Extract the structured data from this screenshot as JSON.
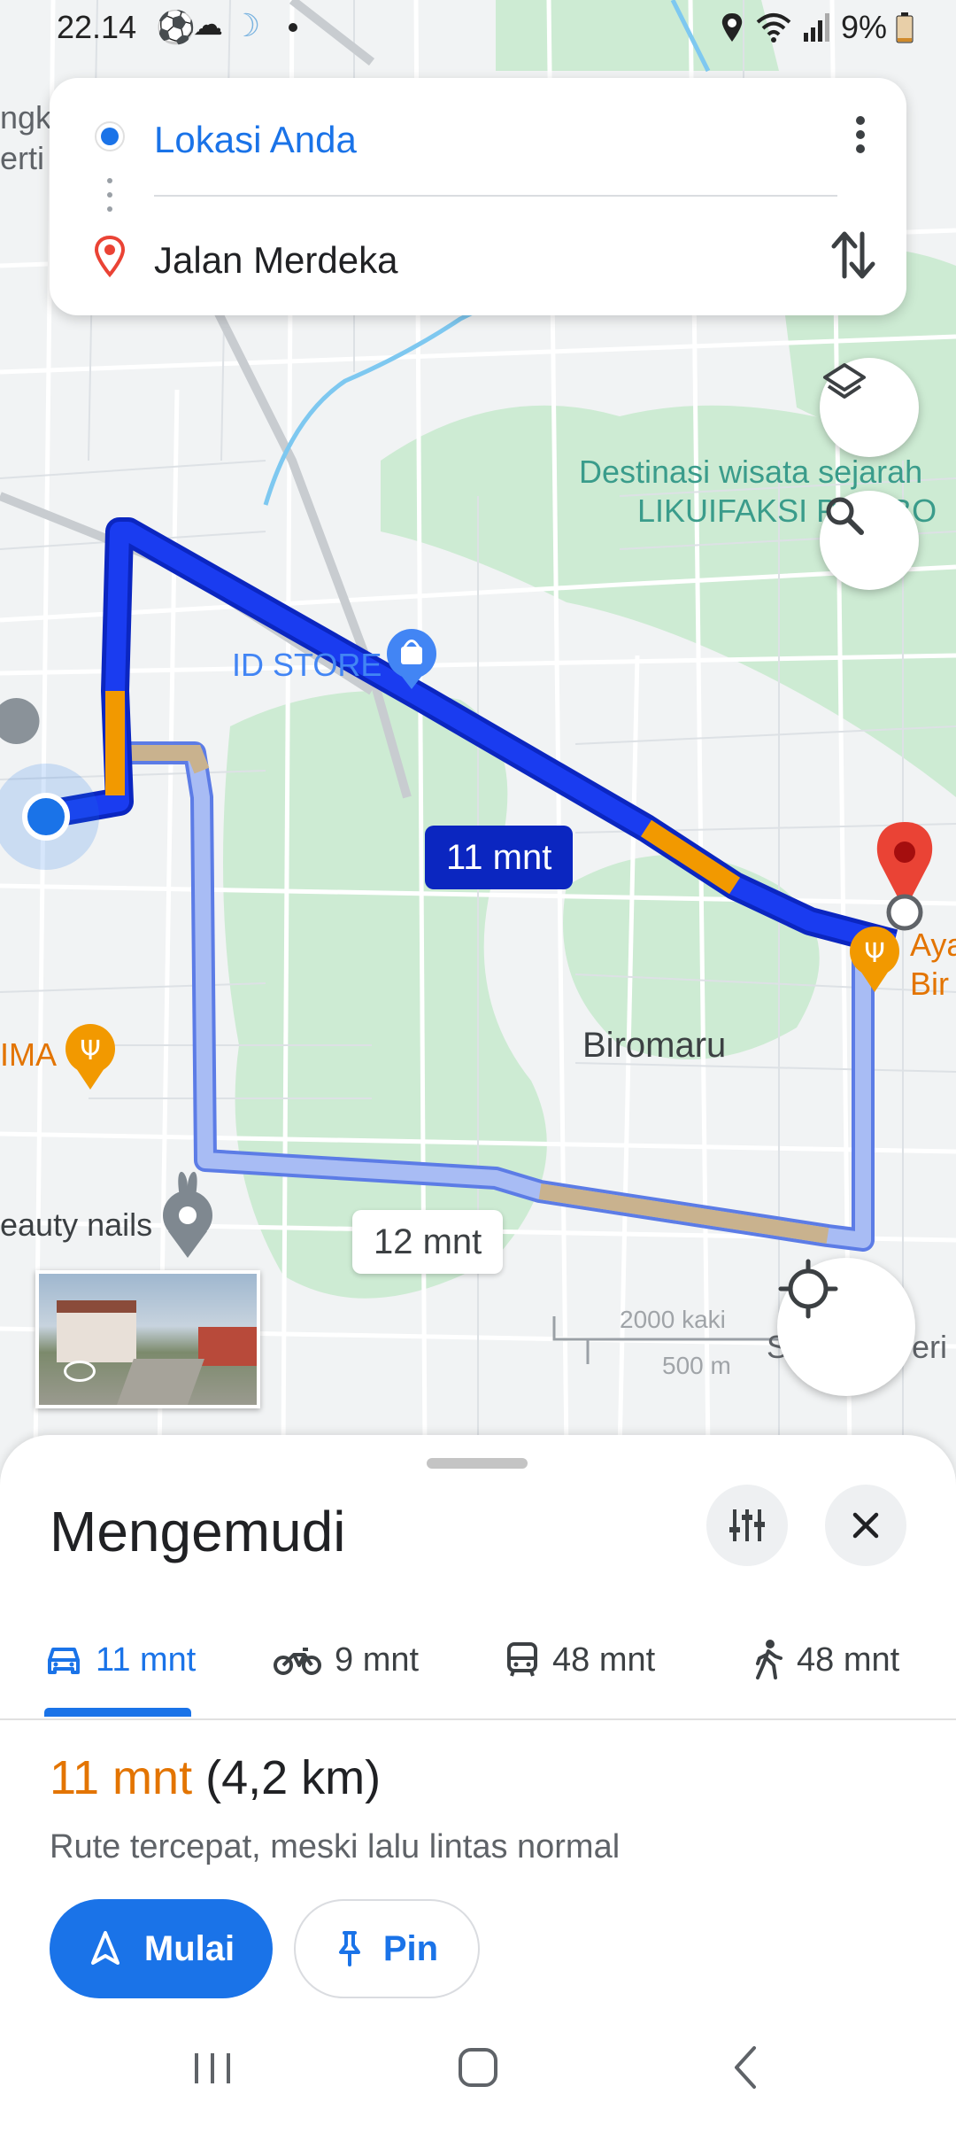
{
  "status_bar": {
    "time": "22.14",
    "battery": "9%",
    "icons": [
      "soccer-ball-icon",
      "cloud-icon",
      "moon-icon",
      "dot-icon",
      "location-icon",
      "wifi-icon",
      "signal-icon",
      "battery-icon"
    ]
  },
  "directions": {
    "origin": "Lokasi Anda",
    "destination": "Jalan Merdeka"
  },
  "map": {
    "labels": {
      "poi_tourism_line1": "Destinasi wisata sejarah",
      "poi_tourism_line2": "LIKUIFAKSI P",
      "poi_tourism_line2_tail": "BO",
      "id_store": "ID STORE",
      "biromaru": "Biromaru",
      "ima": "IMA",
      "beauty_nails": "eauty nails",
      "aya": "Aya",
      "bir": "Bir",
      "left_edge_1": "ngk",
      "left_edge_2": "erti",
      "scale_feet": "2000 kaki",
      "scale_meters": "500 m",
      "s_edge": "S",
      "eri_edge": "eri"
    },
    "routes": {
      "primary_time": "11 mnt",
      "alternate_time": "12 mnt"
    },
    "colors": {
      "primary_route": "#1a3cf0",
      "alternate_route": "#a8bcf4",
      "traffic_moderate": "#f29900",
      "traffic_light": "#c9b28e",
      "destination_pin": "#ea4335",
      "park_green": "#cdebd3",
      "water": "#7ec8f0"
    }
  },
  "sheet": {
    "title": "Mengemudi",
    "tabs": [
      {
        "icon": "car-icon",
        "label": "11 mnt"
      },
      {
        "icon": "motorcycle-icon",
        "label": "9 mnt"
      },
      {
        "icon": "transit-icon",
        "label": "48 mnt"
      },
      {
        "icon": "walking-icon",
        "label": "48 mnt"
      }
    ],
    "summary_time": "11 mnt",
    "summary_distance": "(4,2 km)",
    "summary_note": "Rute tercepat, meski lalu lintas normal",
    "start_label": "Mulai",
    "pin_label": "Pin"
  }
}
